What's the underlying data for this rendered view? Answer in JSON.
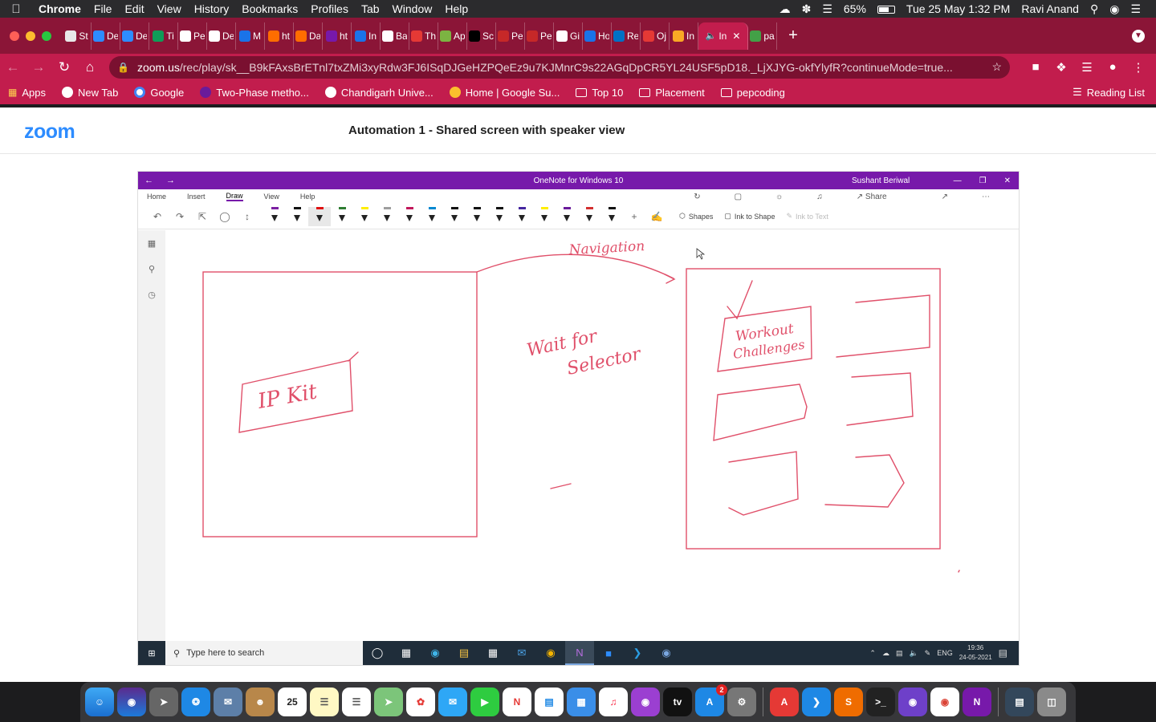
{
  "menubar": {
    "app": "Chrome",
    "items": [
      "File",
      "Edit",
      "View",
      "History",
      "Bookmarks",
      "Profiles",
      "Tab",
      "Window",
      "Help"
    ],
    "battery": "65%",
    "datetime": "Tue 25 May  1:32 PM",
    "user": "Ravi Anand"
  },
  "tabs": [
    {
      "label": "St",
      "color": "#e8e8e8"
    },
    {
      "label": "De",
      "color": "#2d8cff"
    },
    {
      "label": "De",
      "color": "#2d8cff"
    },
    {
      "label": "Ti",
      "color": "#0f9d58"
    },
    {
      "label": "Pe",
      "color": "#ffffff"
    },
    {
      "label": "De",
      "color": "#ffffff"
    },
    {
      "label": "M",
      "color": "#1a73e8"
    },
    {
      "label": "ht",
      "color": "#ff6d00"
    },
    {
      "label": "Da",
      "color": "#ff6d00"
    },
    {
      "label": "ht",
      "color": "#7719aa"
    },
    {
      "label": "In",
      "color": "#1a73e8"
    },
    {
      "label": "Ba",
      "color": "#ffffff"
    },
    {
      "label": "Th",
      "color": "#e53935"
    },
    {
      "label": "Ap",
      "color": "#7cb342"
    },
    {
      "label": "Sc",
      "color": "#000000"
    },
    {
      "label": "Pe",
      "color": "#c62828"
    },
    {
      "label": "Pe",
      "color": "#c62828"
    },
    {
      "label": "Gi",
      "color": "#ffffff"
    },
    {
      "label": "Ho",
      "color": "#1a73e8"
    },
    {
      "label": "Re",
      "color": "#0071c5"
    },
    {
      "label": "Oj",
      "color": "#e53935"
    },
    {
      "label": "In",
      "color": "#f9a825"
    }
  ],
  "active_tab": {
    "label": "In"
  },
  "last_tab": {
    "label": "pa"
  },
  "address_bar": {
    "domain": "zoom.us",
    "path": "/rec/play/sk__B9kFAxsBrETnl7txZMi3xyRdw3FJ6ISqDJGeHZPQeEz9u7KJMnrC9s22AGqDpCR5YL24USF5pD18._LjXJYG-okfYlyfR?continueMode=true..."
  },
  "bookmarks": [
    {
      "label": "Apps",
      "type": "apps"
    },
    {
      "label": "New Tab",
      "type": "site"
    },
    {
      "label": "Google",
      "type": "site"
    },
    {
      "label": "Two-Phase metho...",
      "type": "site"
    },
    {
      "label": "Chandigarh Unive...",
      "type": "site"
    },
    {
      "label": "Home | Google Su...",
      "type": "site"
    },
    {
      "label": "Top 10",
      "type": "folder"
    },
    {
      "label": "Placement",
      "type": "folder"
    },
    {
      "label": "pepcoding",
      "type": "folder"
    }
  ],
  "reading_list": "Reading List",
  "zoom_page": {
    "logo": "zoom",
    "title": "Automation 1 - Shared screen with speaker view"
  },
  "onenote": {
    "window_title": "OneNote for Windows 10",
    "user": "Sushant Beriwal",
    "menu": [
      "Home",
      "Insert",
      "Draw",
      "View",
      "Help"
    ],
    "active_menu": "Draw",
    "share": "Share",
    "ribbon": {
      "shapes": "Shapes",
      "ink_to_shape": "Ink to Shape",
      "ink_to_text": "Ink to Text"
    },
    "pen_colors": [
      "#7b1fa2",
      "#111111",
      "#e01010",
      "#2e7d32",
      "#ffee00",
      "#9e9e9e",
      "#c2185b",
      "#0288d1",
      "#111111",
      "#111111",
      "#111111",
      "#4527a0",
      "#ffee00",
      "#6a1b9a",
      "#d32f2f",
      "#111111"
    ],
    "ink": {
      "navigation": "Navigation",
      "wait_for_selector": [
        "Wait for",
        "Selector"
      ],
      "ip_kit": "IP Kit",
      "workout_challenges": [
        "Workout",
        "Challenges"
      ]
    }
  },
  "windows_taskbar": {
    "search_placeholder": "Type here to search",
    "lang": "ENG",
    "time": "19:36",
    "date": "24-05-2021"
  },
  "colors": {
    "chrome_accent": "#c21d4d",
    "onenote_purple": "#7719aa",
    "ink_red": "#e0506a",
    "zoom_blue": "#2d8cff"
  }
}
